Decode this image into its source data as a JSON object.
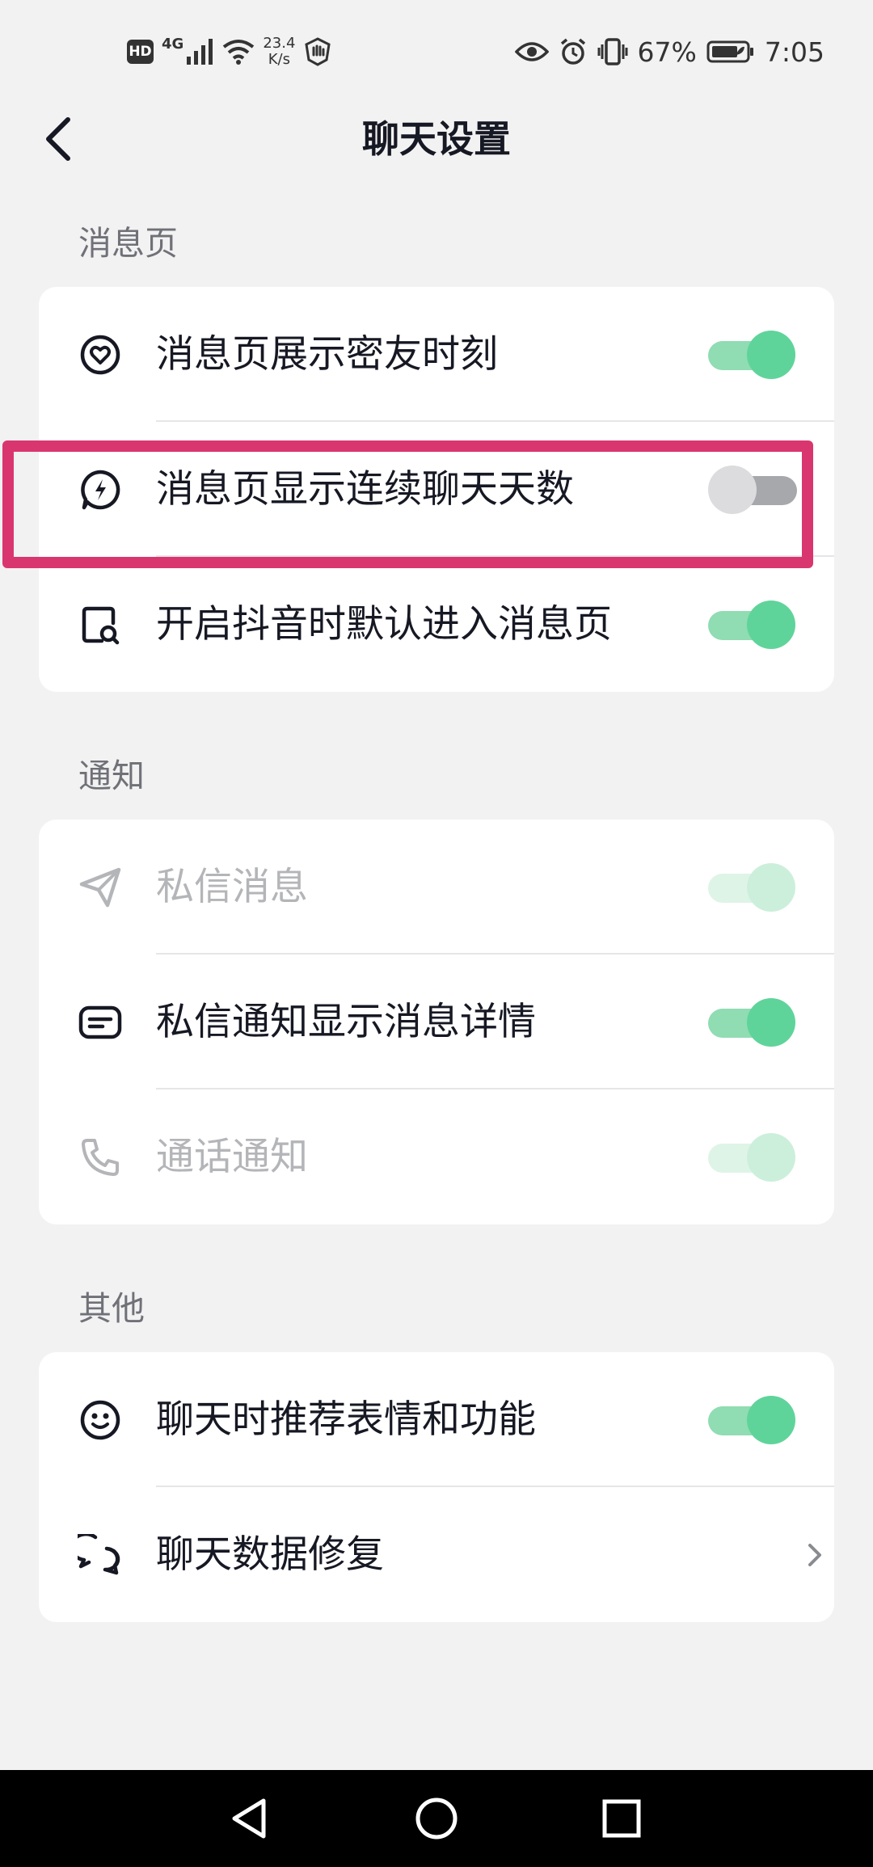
{
  "status_bar": {
    "hd": "HD",
    "network_type": "4G",
    "speed_value": "23.4",
    "speed_unit": "K/s",
    "battery_percent": "67%",
    "time": "7:05"
  },
  "header": {
    "title": "聊天设置",
    "back_icon": "chevron-left-icon"
  },
  "sections": {
    "message_page": {
      "label": "消息页",
      "rows": [
        {
          "label": "消息页展示密友时刻",
          "icon": "heart-circle-icon",
          "toggle": "on"
        },
        {
          "label": "消息页显示连续聊天天数",
          "icon": "lightning-bubble-icon",
          "toggle": "off"
        },
        {
          "label": "开启抖音时默认进入消息页",
          "icon": "page-search-icon",
          "toggle": "on"
        }
      ]
    },
    "notification": {
      "label": "通知",
      "rows": [
        {
          "label": "私信消息",
          "icon": "paper-plane-icon",
          "toggle": "on",
          "disabled": true
        },
        {
          "label": "私信通知显示消息详情",
          "icon": "message-card-icon",
          "toggle": "on"
        },
        {
          "label": "通话通知",
          "icon": "phone-icon",
          "toggle": "on",
          "disabled": true
        }
      ]
    },
    "other": {
      "label": "其他",
      "rows": [
        {
          "label": "聊天时推荐表情和功能",
          "icon": "smiley-icon",
          "toggle": "on"
        },
        {
          "label": "聊天数据修复",
          "icon": "chat-bubbles-icon",
          "action": "chevron-right-icon"
        }
      ]
    }
  },
  "colors": {
    "toggle_on": "#5fd49a",
    "toggle_off": "#a7a8ac",
    "highlight": "#d9366f",
    "background": "#f2f2f2"
  }
}
